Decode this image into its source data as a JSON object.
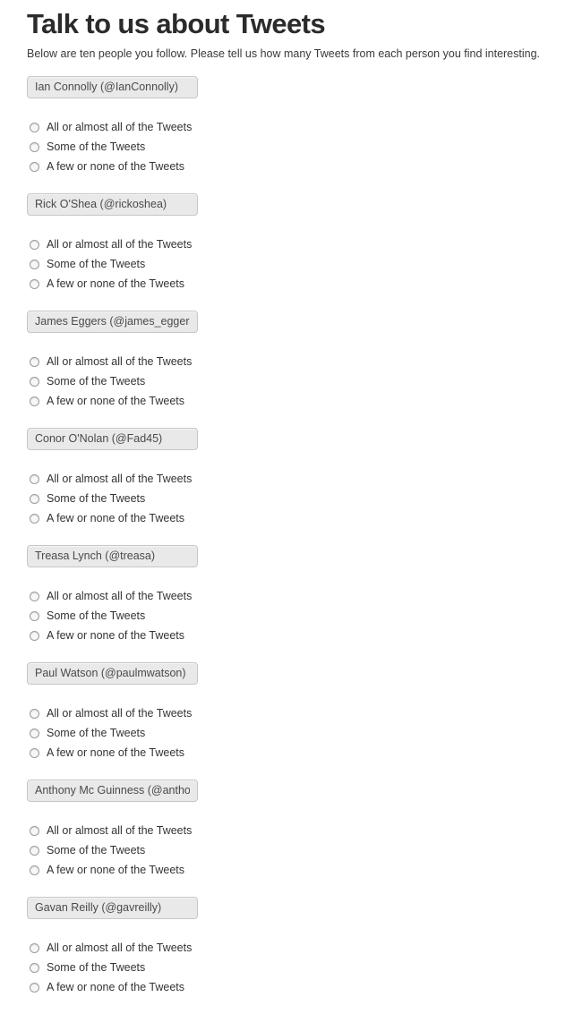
{
  "header": {
    "title": "Talk to us about Tweets",
    "intro": "Below are ten people you follow. Please tell us how many Tweets from each person you find interesting."
  },
  "options": {
    "all": "All or almost all of the Tweets",
    "some": "Some of the Tweets",
    "few": "A few or none of the Tweets"
  },
  "people": [
    {
      "name": "Ian Connolly (@IanConnolly)"
    },
    {
      "name": "Rick O'Shea (@rickoshea)"
    },
    {
      "name": "James Eggers (@james_eggers)"
    },
    {
      "name": "Conor O'Nolan (@Fad45)"
    },
    {
      "name": "Treasa Lynch (@treasa)"
    },
    {
      "name": "Paul Watson (@paulmwatson)"
    },
    {
      "name": "Anthony Mc Guinness (@anthonymcg)"
    },
    {
      "name": "Gavan Reilly (@gavreilly)"
    }
  ]
}
